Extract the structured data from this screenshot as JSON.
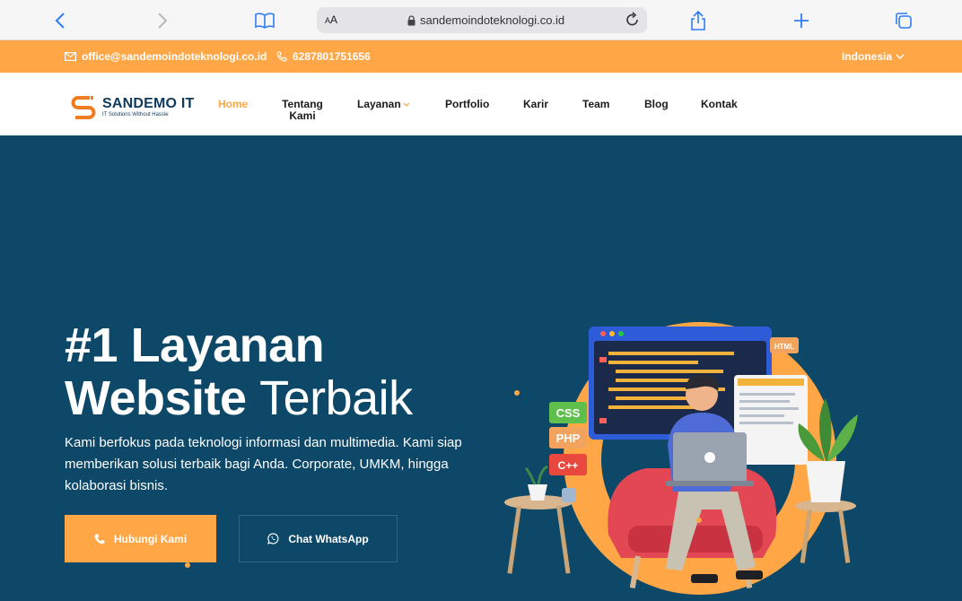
{
  "browser": {
    "text_size_label": "AA",
    "url": "sandemoindoteknologi.co.id"
  },
  "topbar": {
    "email": "office@sandemoindoteknologi.co.id",
    "phone": "6287801751656",
    "language": "Indonesia"
  },
  "nav": {
    "logo_name": "SANDEMO IT",
    "logo_tagline": "IT Solutions Without Hassle",
    "items": [
      {
        "label": "Home"
      },
      {
        "label": "Tentang Kami"
      },
      {
        "label": "Layanan"
      },
      {
        "label": "Portfolio"
      },
      {
        "label": "Karir"
      },
      {
        "label": "Team"
      },
      {
        "label": "Blog"
      },
      {
        "label": "Kontak"
      }
    ]
  },
  "hero": {
    "title_line1": "#1 Layanan",
    "title_line2_bold": "Website",
    "title_line2_thin": "Terbaik",
    "description": "Kami berfokus pada teknologi informasi dan multimedia. Kami siap memberikan solusi terbaik bagi Anda. Corporate, UMKM, hingga kolaborasi bisnis.",
    "primary_button": "Hubungi Kami",
    "secondary_button": "Chat WhatsApp",
    "illustration_labels": {
      "css": "CSS",
      "php": "PHP",
      "cpp": "C++",
      "html": "HTML"
    }
  },
  "colors": {
    "accent": "#ffa646",
    "hero_bg": "#0e4868",
    "brand_dark": "#0f3a5c"
  }
}
